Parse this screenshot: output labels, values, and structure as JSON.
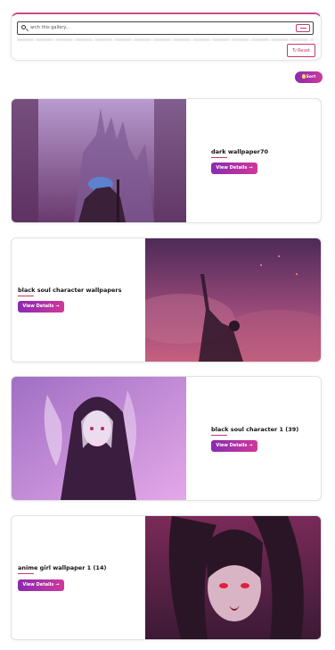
{
  "search": {
    "placeholder": "arch this gallery...",
    "reset_label": "Reset",
    "reset_icon": "↻"
  },
  "sort_button": {
    "label": "Sort"
  },
  "cards": [
    {
      "title": "dark wallpaper70",
      "button_label": "View Details",
      "arrow": "→"
    },
    {
      "title": "black soul character wallpapers",
      "button_label": "View Details",
      "arrow": "→"
    },
    {
      "title": "black soul character 1 (39)",
      "button_label": "View Details",
      "arrow": "→"
    },
    {
      "title": "anime girl wallpaper 1 (14)",
      "button_label": "View Details",
      "arrow": "→"
    }
  ],
  "colors": {
    "accent": "#c23a6f",
    "gradient_start": "#8a2ab0",
    "gradient_end": "#d0389a"
  }
}
